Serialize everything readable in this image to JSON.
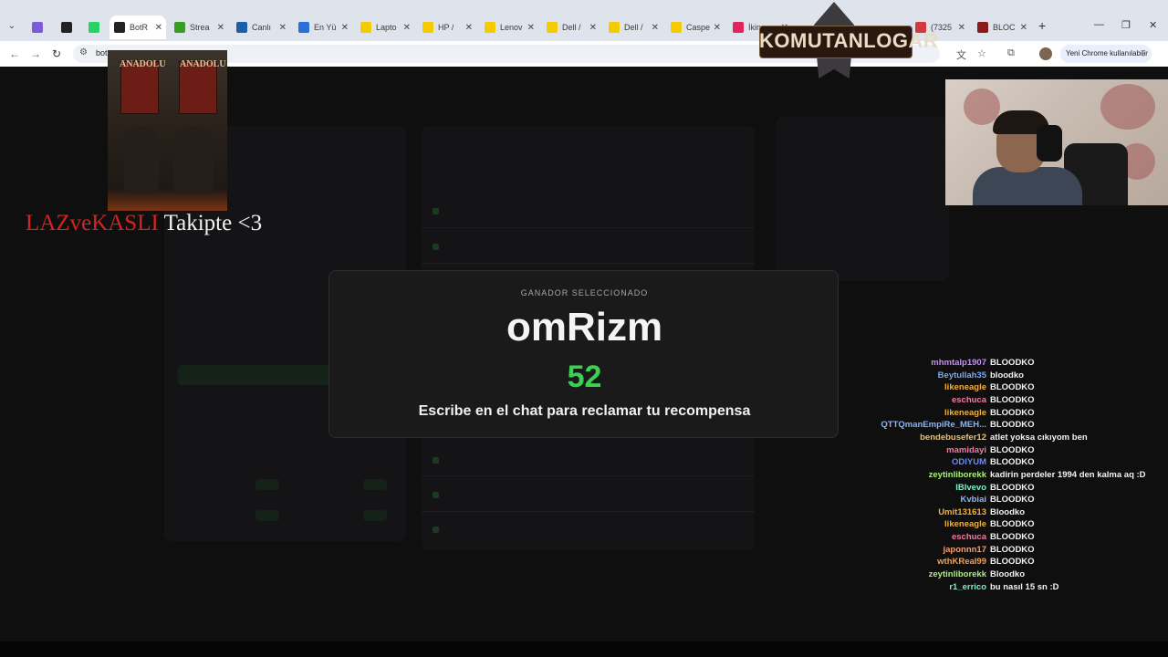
{
  "browser": {
    "tabs": [
      {
        "label": "",
        "icon": "tracker-icon",
        "color": "#7b5cd6"
      },
      {
        "label": "",
        "icon": "github-icon",
        "color": "#222222"
      },
      {
        "label": "",
        "icon": "whatsapp-icon",
        "color": "#25d366"
      },
      {
        "label": "BotR",
        "icon": "botrix-icon",
        "color": "#222222",
        "active": true
      },
      {
        "label": "Strea",
        "icon": "kick-icon",
        "color": "#3a9d23"
      },
      {
        "label": "Canlı",
        "icon": "linkedin-icon",
        "color": "#1b5fa8"
      },
      {
        "label": "En Yü",
        "icon": "mail-icon",
        "color": "#2a6fd6"
      },
      {
        "label": "Lapto",
        "icon": "shop-icon",
        "color": "#f2cc00"
      },
      {
        "label": "HP /",
        "icon": "shop-icon",
        "color": "#f2cc00"
      },
      {
        "label": "Lenov",
        "icon": "shop-icon",
        "color": "#f2cc00"
      },
      {
        "label": "Dell /",
        "icon": "shop-icon",
        "color": "#f2cc00"
      },
      {
        "label": "Dell /",
        "icon": "shop-icon",
        "color": "#f2cc00"
      },
      {
        "label": "Caspe",
        "icon": "shop-icon",
        "color": "#f2cc00"
      },
      {
        "label": "İkinc",
        "icon": "market-icon",
        "color": "#e0245e"
      },
      {
        "label": "(7325",
        "icon": "twitch-icon",
        "color": "#d23b3b"
      },
      {
        "label": "BLOC",
        "icon": "blood-icon",
        "color": "#8b1a1a"
      }
    ],
    "address": "bot",
    "profile_label": "Yeni Chrome kullanılabilir"
  },
  "overlay": {
    "follow_name": "LAZveKASLI",
    "follow_text": " Takipte <3",
    "poster_banner_left": "ANADOLU",
    "poster_banner_right": "ANADOLU",
    "logo_text": "KOMUTANLOGAR"
  },
  "modal": {
    "label": "GANADOR SELECCIONADO",
    "winner": "omRizm",
    "countdown": "52",
    "message": "Escribe en el chat para reclamar tu recompensa"
  },
  "chat": [
    {
      "user": "mhmtalp1907",
      "color": "#c98cf0",
      "msg": "BLOODKO"
    },
    {
      "user": "Beytullah35",
      "color": "#7aa8f0",
      "msg": "bloodko"
    },
    {
      "user": "likeneagle",
      "color": "#f0b040",
      "msg": "BLOODKO"
    },
    {
      "user": "eschuca",
      "color": "#f07aa0",
      "msg": "BLOODKO"
    },
    {
      "user": "likeneagle",
      "color": "#f0b040",
      "msg": "BLOODKO"
    },
    {
      "user": "QTTQmanEmpiRe_MEH...",
      "color": "#8ab4f8",
      "msg": "BLOODKO"
    },
    {
      "user": "bendebusefer12",
      "color": "#f0c060",
      "msg": "atlet yoksa cıkıyom ben"
    },
    {
      "user": "mamidayi",
      "color": "#f07aa0",
      "msg": "BLOODKO"
    },
    {
      "user": "ODIYUM",
      "color": "#6a8af0",
      "msg": "BLOODKO"
    },
    {
      "user": "zeytinliborekk",
      "color": "#a8f07a",
      "msg": "kadirin perdeler 1994 den kalma aq :D"
    },
    {
      "user": "IBlvevo",
      "color": "#7af0c0",
      "msg": "BLOODKO"
    },
    {
      "user": "Kvbiai",
      "color": "#8ab4f8",
      "msg": "BLOODKO"
    },
    {
      "user": "Umit131613",
      "color": "#f0b040",
      "msg": "Bloodko"
    },
    {
      "user": "likeneagle",
      "color": "#f0b040",
      "msg": "BLOODKO"
    },
    {
      "user": "eschuca",
      "color": "#f07aa0",
      "msg": "BLOODKO"
    },
    {
      "user": "japonnn17",
      "color": "#f0a070",
      "msg": "BLOODKO"
    },
    {
      "user": "wthKReal99",
      "color": "#f0a050",
      "msg": "BLOODKO"
    },
    {
      "user": "zeytinliborekk",
      "color": "#a8f07a",
      "msg": "Bloodko"
    },
    {
      "user": "r1_errico",
      "color": "#7af0c0",
      "msg": "bu nasıl 15 sn :D"
    }
  ]
}
